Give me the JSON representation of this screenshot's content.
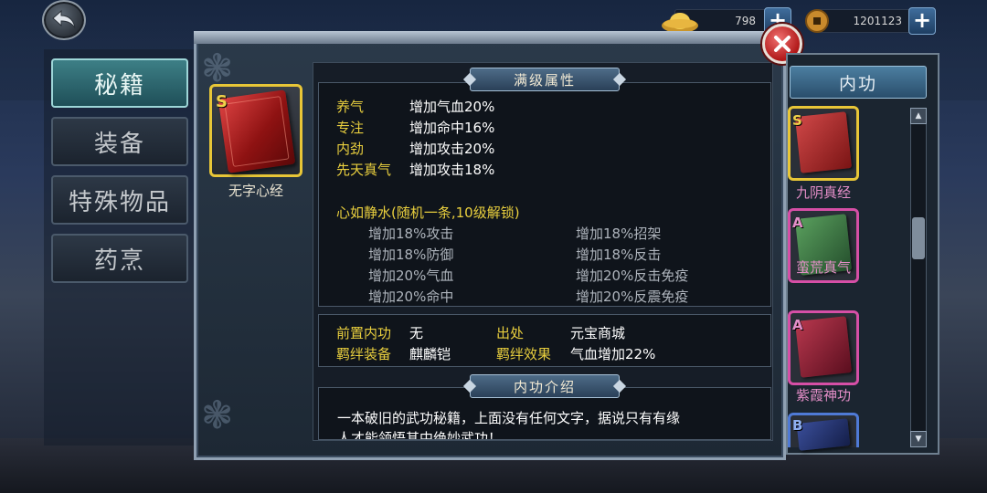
{
  "currency": {
    "gold_icon": "gold-ingot-icon",
    "gold_amount": "798",
    "coin_icon": "copper-coin-icon",
    "coin_amount": "1201123",
    "plus_label": "+"
  },
  "categories": [
    {
      "label": "秘籍",
      "active": true
    },
    {
      "label": "装备",
      "active": false
    },
    {
      "label": "特殊物品",
      "active": false
    },
    {
      "label": "药烹",
      "active": false
    }
  ],
  "selected_item": {
    "grade": "S",
    "name": "无字心经"
  },
  "max_attributes": {
    "header": "满级属性",
    "rows": [
      {
        "name": "养气",
        "value": "增加气血20%"
      },
      {
        "name": "专注",
        "value": "增加命中16%"
      },
      {
        "name": "内劲",
        "value": "增加攻击20%"
      },
      {
        "name": "先天真气",
        "value": "增加攻击18%"
      }
    ],
    "random_title": "心如静水(随机一条,10级解锁)",
    "random_options": [
      "增加18%攻击",
      "增加18%招架",
      "增加18%防御",
      "增加18%反击",
      "增加20%气血",
      "增加20%反击免疫",
      "增加20%命中",
      "增加20%反震免疫"
    ]
  },
  "info": {
    "prereq_label": "前置内功",
    "prereq_value": "无",
    "source_label": "出处",
    "source_value": "元宝商城",
    "bond_equip_label": "羁绊装备",
    "bond_equip_value": "麒麟铠",
    "bond_effect_label": "羁绊效果",
    "bond_effect_value": "气血增加22%"
  },
  "intro": {
    "header": "内功介绍",
    "line1": "一本破旧的武功秘籍，上面没有任何文字，据说只有有缘",
    "line2": "人才能领悟其中绝妙武功！"
  },
  "right_list": {
    "tab_label": "内功",
    "items": [
      {
        "grade": "S",
        "name": "九阴真经",
        "border": "#e8c637",
        "book": "#8a1e1e"
      },
      {
        "grade": "A",
        "name": "蛮荒真气",
        "border": "#d64fa6",
        "book": "#2f6b3a"
      },
      {
        "grade": "A",
        "name": "紫霞神功",
        "border": "#d64fa6",
        "book": "#7a1a2a"
      },
      {
        "grade": "B",
        "name": "",
        "border": "#4f7ad6",
        "book": "#1c2a5a"
      }
    ]
  }
}
